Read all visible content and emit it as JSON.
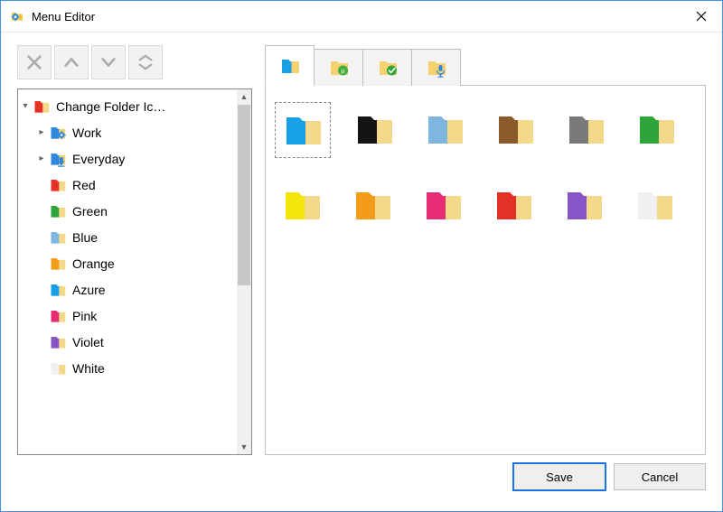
{
  "window": {
    "title": "Menu Editor"
  },
  "toolbar": {
    "delete": "delete",
    "up": "move up",
    "down": "move down",
    "sort": "sort"
  },
  "tree": {
    "root": {
      "label": "Change Folder Ic…",
      "expanded": true,
      "front": "#e53026",
      "back": "#f5d98a"
    },
    "nodes": [
      {
        "label": "Work",
        "type": "branch",
        "expanded": false,
        "front": "#2f88e0",
        "back": "#f5d270",
        "overlay": "gear"
      },
      {
        "label": "Everyday",
        "type": "branch",
        "expanded": false,
        "front": "#2f88e0",
        "back": "#f5d270",
        "overlay": "down"
      },
      {
        "label": "Red",
        "type": "leaf",
        "front": "#e53026",
        "back": "#f5d98a"
      },
      {
        "label": "Green",
        "type": "leaf",
        "front": "#2fa43a",
        "back": "#f5d98a"
      },
      {
        "label": "Blue",
        "type": "leaf",
        "front": "#7fb6e0",
        "back": "#f5d98a"
      },
      {
        "label": "Orange",
        "type": "leaf",
        "front": "#f39b1a",
        "back": "#f5d98a"
      },
      {
        "label": "Azure",
        "type": "leaf",
        "front": "#17a0e6",
        "back": "#f5d98a"
      },
      {
        "label": "Pink",
        "type": "leaf",
        "front": "#e62c73",
        "back": "#f5d98a"
      },
      {
        "label": "Violet",
        "type": "leaf",
        "front": "#8855c9",
        "back": "#f5d98a"
      },
      {
        "label": "White",
        "type": "leaf",
        "front": "#f0f0f0",
        "back": "#f5d98a"
      }
    ]
  },
  "tabs": [
    {
      "name": "colors",
      "front": "#17a0e6",
      "back": "#f5d270",
      "overlay": "none",
      "active": true
    },
    {
      "name": "torrent",
      "front": "#f5d270",
      "back": "#f5d270",
      "overlay": "mu",
      "active": false
    },
    {
      "name": "checked",
      "front": "#f5d270",
      "back": "#f5d270",
      "overlay": "check",
      "active": false
    },
    {
      "name": "mic",
      "front": "#f5d270",
      "back": "#f5d270",
      "overlay": "mic",
      "active": false
    }
  ],
  "grid": [
    {
      "front": "#17a0e6",
      "back": "#f5d98a",
      "selected": true
    },
    {
      "front": "#141414",
      "back": "#f5d98a"
    },
    {
      "front": "#7fb6e0",
      "back": "#f5d98a"
    },
    {
      "front": "#8a5a2b",
      "back": "#f5d98a"
    },
    {
      "front": "#7a7a7a",
      "back": "#f5d98a"
    },
    {
      "front": "#2fa43a",
      "back": "#f5d98a"
    },
    {
      "front": "#f4e50a",
      "back": "#f5d98a"
    },
    {
      "front": "#f39b1a",
      "back": "#f5d98a"
    },
    {
      "front": "#e62c73",
      "back": "#f5d98a"
    },
    {
      "front": "#e53026",
      "back": "#f5d98a"
    },
    {
      "front": "#8855c9",
      "back": "#f5d98a"
    },
    {
      "front": "#f0f0f0",
      "back": "#f5d98a"
    }
  ],
  "buttons": {
    "save": "Save",
    "cancel": "Cancel"
  }
}
